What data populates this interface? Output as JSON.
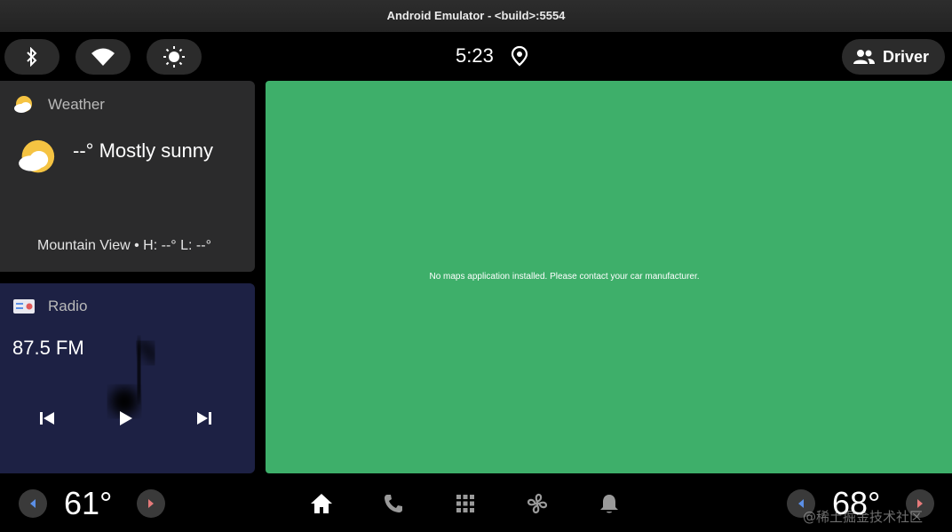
{
  "window": {
    "title": "Android Emulator - <build>:5554"
  },
  "status_bar": {
    "time": "5:23",
    "quick_settings": [
      "bluetooth-icon",
      "wifi-icon",
      "brightness-icon"
    ],
    "profile_label": "Driver"
  },
  "weather_card": {
    "title": "Weather",
    "condition_text": "--° Mostly sunny",
    "location_line": "Mountain View • H: --° L: --°",
    "icon": "partly-sunny-icon"
  },
  "radio_card": {
    "title": "Radio",
    "frequency": "87.5 FM",
    "controls": [
      "skip-previous-icon",
      "play-icon",
      "skip-next-icon"
    ]
  },
  "map_area": {
    "message": "No maps application installed. Please contact your car manufacturer.",
    "background_color": "#3eaf6a"
  },
  "nav_bar": {
    "driver_temp": "61°",
    "passenger_temp": "68°",
    "icons": [
      "home-icon",
      "phone-icon",
      "app-grid-icon",
      "fan-icon",
      "notification-bell-icon"
    ]
  },
  "watermark": "@稀土掘金技术社区",
  "colors": {
    "weather_card_bg": "#2b2b2c",
    "radio_card_bg": "#1d2144",
    "accent_blue": "#5b8fe6",
    "accent_red": "#e57a7a"
  }
}
